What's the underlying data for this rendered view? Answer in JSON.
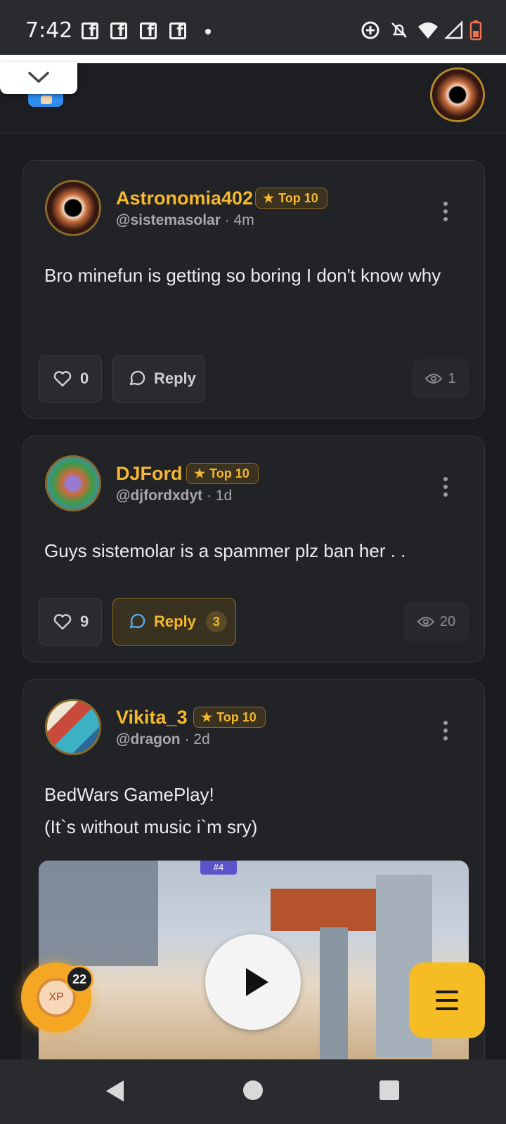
{
  "status_bar": {
    "time": "7:42",
    "icons": [
      "facebook-icon",
      "facebook-icon",
      "facebook-icon",
      "facebook-icon",
      "dot-icon",
      "data-saver-icon",
      "notifications-off-icon",
      "wifi-icon",
      "signal-icon",
      "battery-low-icon"
    ]
  },
  "header": {
    "collapse_icon": "chevron-down-icon",
    "avatar_icon": "black-hole-avatar"
  },
  "posts": [
    {
      "username": "Astronomia402",
      "badge": "Top 10",
      "handle": "@sistemasolar",
      "time": "· 4m",
      "body": "Bro minefun is getting so boring I don't know why",
      "likes": "0",
      "reply_label": "Reply",
      "views": "1"
    },
    {
      "username": "DJFord",
      "badge": "Top 10",
      "handle": "@djfordxdyt",
      "time": "· 1d",
      "body": "Guys sistemolar is a spammer plz ban her . .",
      "likes": "9",
      "reply_label": "Reply",
      "reply_count": "3",
      "views": "20"
    },
    {
      "username": "Vikita_3",
      "badge": "Top 10",
      "handle": "@dragon",
      "time": "· 2d",
      "body": "BedWars GamePlay!\n(It`s without music i`m sry)",
      "video_badge": "#4"
    }
  ],
  "fabs": {
    "xp_label": "XP",
    "xp_count": "22"
  },
  "colors": {
    "background": "#1b1c1f",
    "card": "#222327",
    "accent": "#f5b82e",
    "menu_fab": "#f5bc24"
  }
}
